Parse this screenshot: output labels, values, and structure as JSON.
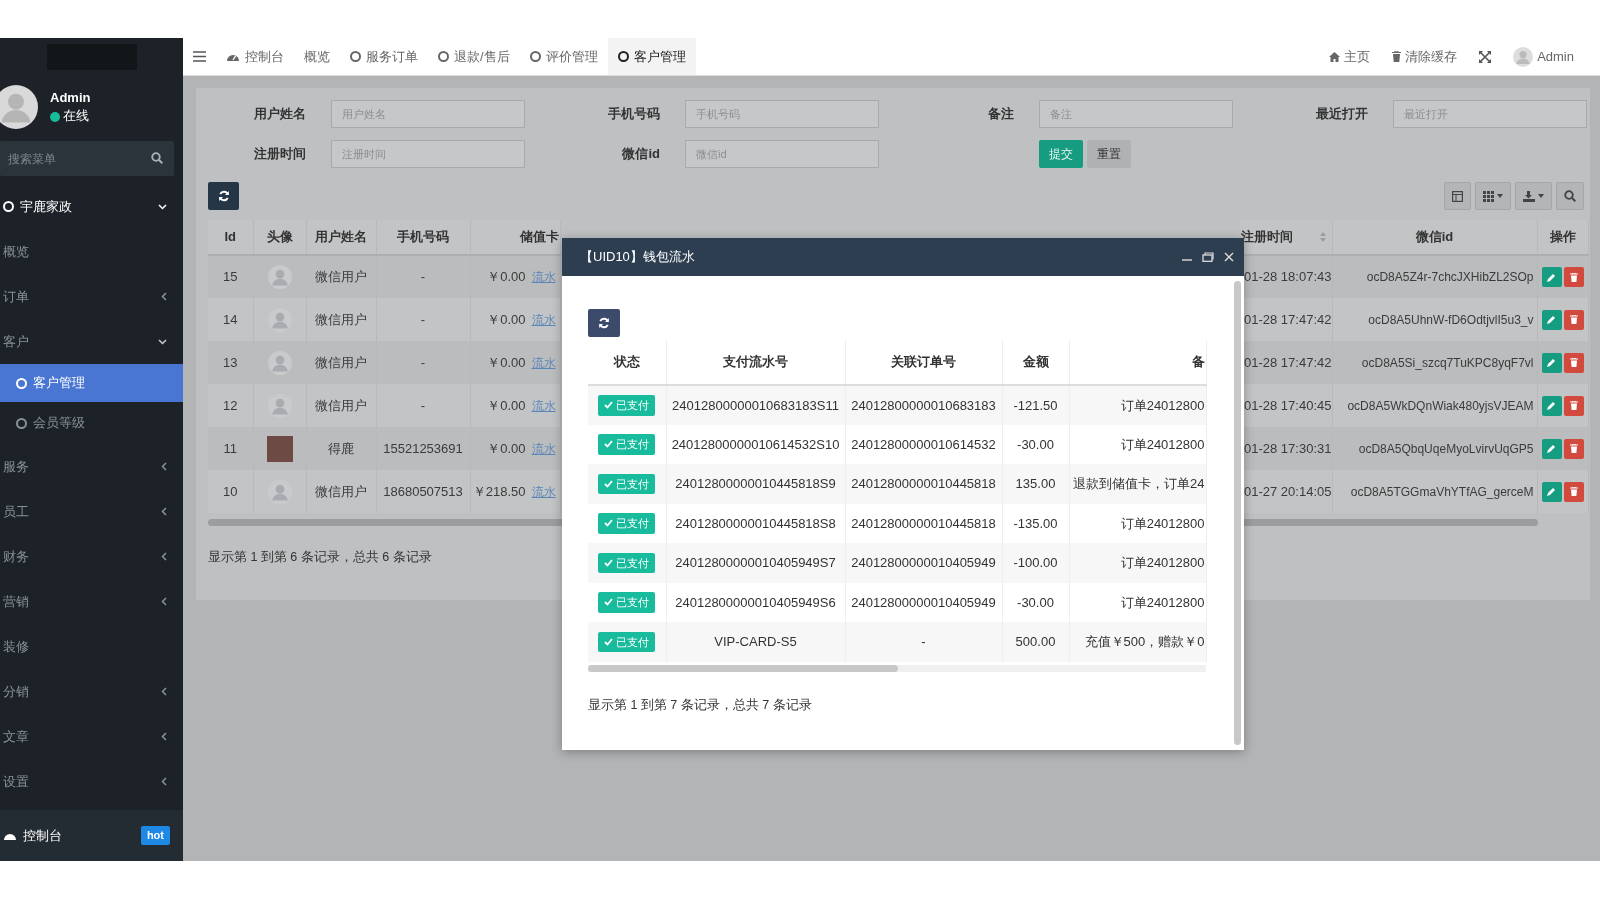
{
  "sidebar": {
    "user": {
      "name": "Admin",
      "status": "在线",
      "online": true
    },
    "search": {
      "placeholder": "搜索菜单"
    },
    "menu": [
      {
        "label": "宇鹿家政",
        "kind": "folder",
        "expanded": true,
        "selected": false,
        "children": [
          {
            "label": "概览",
            "kind": "link",
            "selected": false
          },
          {
            "label": "订单",
            "kind": "folder",
            "expanded": false,
            "selected": false
          },
          {
            "label": "客户",
            "kind": "folder",
            "expanded": true,
            "selected": false,
            "children": [
              {
                "label": "客户管理",
                "kind": "link",
                "selected": true
              },
              {
                "label": "会员等级",
                "kind": "link",
                "selected": false
              }
            ]
          },
          {
            "label": "服务",
            "kind": "folder",
            "expanded": false,
            "selected": false
          },
          {
            "label": "员工",
            "kind": "folder",
            "expanded": false,
            "selected": false
          },
          {
            "label": "财务",
            "kind": "folder",
            "expanded": false,
            "selected": false
          },
          {
            "label": "营销",
            "kind": "folder",
            "expanded": false,
            "selected": false
          },
          {
            "label": "装修",
            "kind": "link",
            "selected": false
          },
          {
            "label": "分销",
            "kind": "folder",
            "expanded": false,
            "selected": false
          },
          {
            "label": "文章",
            "kind": "folder",
            "expanded": false,
            "selected": false
          },
          {
            "label": "设置",
            "kind": "folder",
            "expanded": false,
            "selected": false
          }
        ]
      }
    ],
    "footer": {
      "label": "控制台",
      "badge": "hot"
    }
  },
  "topbar": {
    "tabs": [
      {
        "label": "控制台",
        "kind": "dashboard",
        "selected": false
      },
      {
        "label": "概览",
        "kind": "plain",
        "selected": false
      },
      {
        "label": "服务订单",
        "kind": "circle",
        "selected": false
      },
      {
        "label": "退款/售后",
        "kind": "circle",
        "selected": false
      },
      {
        "label": "评价管理",
        "kind": "circle",
        "selected": false
      },
      {
        "label": "客户管理",
        "kind": "circle",
        "selected": true
      }
    ],
    "links": [
      {
        "label": "主页",
        "kind": "home"
      },
      {
        "label": "清除缓存",
        "kind": "trash"
      },
      {
        "kind": "fullscreen"
      },
      {
        "label": "Admin",
        "kind": "user"
      }
    ]
  },
  "filters": [
    {
      "label": "用户姓名",
      "placeholder": "用户姓名"
    },
    {
      "label": "手机号码",
      "placeholder": "手机号码"
    },
    {
      "label": "备注",
      "placeholder": "备注"
    },
    {
      "label": "最近打开",
      "placeholder": "最近打开"
    },
    {
      "label": "注册时间",
      "placeholder": "注册时间"
    },
    {
      "label": "微信id",
      "placeholder": "微信id"
    }
  ],
  "filter_buttons": [
    {
      "label": "提交",
      "kind": "primary"
    },
    {
      "label": "重置",
      "kind": "default"
    }
  ],
  "table": {
    "columns": [
      {
        "label": "Id",
        "sortable": false
      },
      {
        "label": "头像",
        "sortable": false
      },
      {
        "label": "用户姓名",
        "sortable": false
      },
      {
        "label": "手机号码",
        "sortable": false
      },
      {
        "label": "储值卡",
        "sortable": false
      },
      {
        "label": "注册时间",
        "sortable": true
      },
      {
        "label": "微信id",
        "sortable": false
      },
      {
        "label": "操作",
        "sortable": false
      }
    ],
    "rows": [
      {
        "id": "15",
        "avatar": {
          "kind": "default"
        },
        "name": "微信用户",
        "phone": "-",
        "balance": "￥0.00",
        "flow_link": "流水",
        "registered": "01-28 18:07:43",
        "wechat_id": "ocD8A5Z4r-7chcJXHibZL2SOp"
      },
      {
        "id": "14",
        "avatar": {
          "kind": "default"
        },
        "name": "微信用户",
        "phone": "-",
        "balance": "￥0.00",
        "flow_link": "流水",
        "registered": "01-28 17:47:42",
        "wechat_id": "ocD8A5UhnW-fD6OdtjvlI5u3_v"
      },
      {
        "id": "13",
        "avatar": {
          "kind": "default"
        },
        "name": "微信用户",
        "phone": "-",
        "balance": "￥0.00",
        "flow_link": "流水",
        "registered": "01-28 17:47:42",
        "wechat_id": "ocD8A5Si_szcq7TuKPC8yqF7vl"
      },
      {
        "id": "12",
        "avatar": {
          "kind": "default"
        },
        "name": "微信用户",
        "phone": "-",
        "balance": "￥0.00",
        "flow_link": "流水",
        "registered": "01-28 17:40:45",
        "wechat_id": "ocD8A5WkDQnWiak480yjsVJEAM"
      },
      {
        "id": "11",
        "avatar": {
          "kind": "photo"
        },
        "name": "得鹿",
        "phone": "15521253691",
        "balance": "￥0.00",
        "flow_link": "流水",
        "registered": "01-28 17:30:31",
        "wechat_id": "ocD8A5QbqUqeMyoLvirvUqGP5"
      },
      {
        "id": "10",
        "avatar": {
          "kind": "default"
        },
        "name": "微信用户",
        "phone": "18680507513",
        "balance": "￥218.50",
        "flow_link": "流水",
        "registered": "01-27 20:14:05",
        "wechat_id": "ocD8A5TGGmaVhYTfAG_gerceM"
      }
    ],
    "pagination": "显示第 1 到第 6 条记录，总共 6 条记录"
  },
  "dialog": {
    "title": "【UID10】钱包流水",
    "columns": [
      "状态",
      "支付流水号",
      "关联订单号",
      "金额",
      "备"
    ],
    "rows": [
      {
        "status": {
          "label": "已支付",
          "kind": "paid"
        },
        "serial": "24012800000010683183S11",
        "order": "24012800000010683183",
        "amount": "-121.50",
        "remark": "订单24012800"
      },
      {
        "status": {
          "label": "已支付",
          "kind": "paid"
        },
        "serial": "24012800000010614532S10",
        "order": "24012800000010614532",
        "amount": "-30.00",
        "remark": "订单24012800"
      },
      {
        "status": {
          "label": "已支付",
          "kind": "paid"
        },
        "serial": "24012800000010445818S9",
        "order": "24012800000010445818",
        "amount": "135.00",
        "remark": "退款到储值卡，订单24"
      },
      {
        "status": {
          "label": "已支付",
          "kind": "paid"
        },
        "serial": "24012800000010445818S8",
        "order": "24012800000010445818",
        "amount": "-135.00",
        "remark": "订单24012800"
      },
      {
        "status": {
          "label": "已支付",
          "kind": "paid"
        },
        "serial": "24012800000010405949S7",
        "order": "24012800000010405949",
        "amount": "-100.00",
        "remark": "订单24012800"
      },
      {
        "status": {
          "label": "已支付",
          "kind": "paid"
        },
        "serial": "24012800000010405949S6",
        "order": "24012800000010405949",
        "amount": "-30.00",
        "remark": "订单24012800"
      },
      {
        "status": {
          "label": "已支付",
          "kind": "paid"
        },
        "serial": "VIP-CARD-S5",
        "order": "-",
        "amount": "500.00",
        "remark": "充值￥500，赠款￥0"
      }
    ],
    "pagination": "显示第 1 到第 7 条记录，总共 7 条记录"
  }
}
